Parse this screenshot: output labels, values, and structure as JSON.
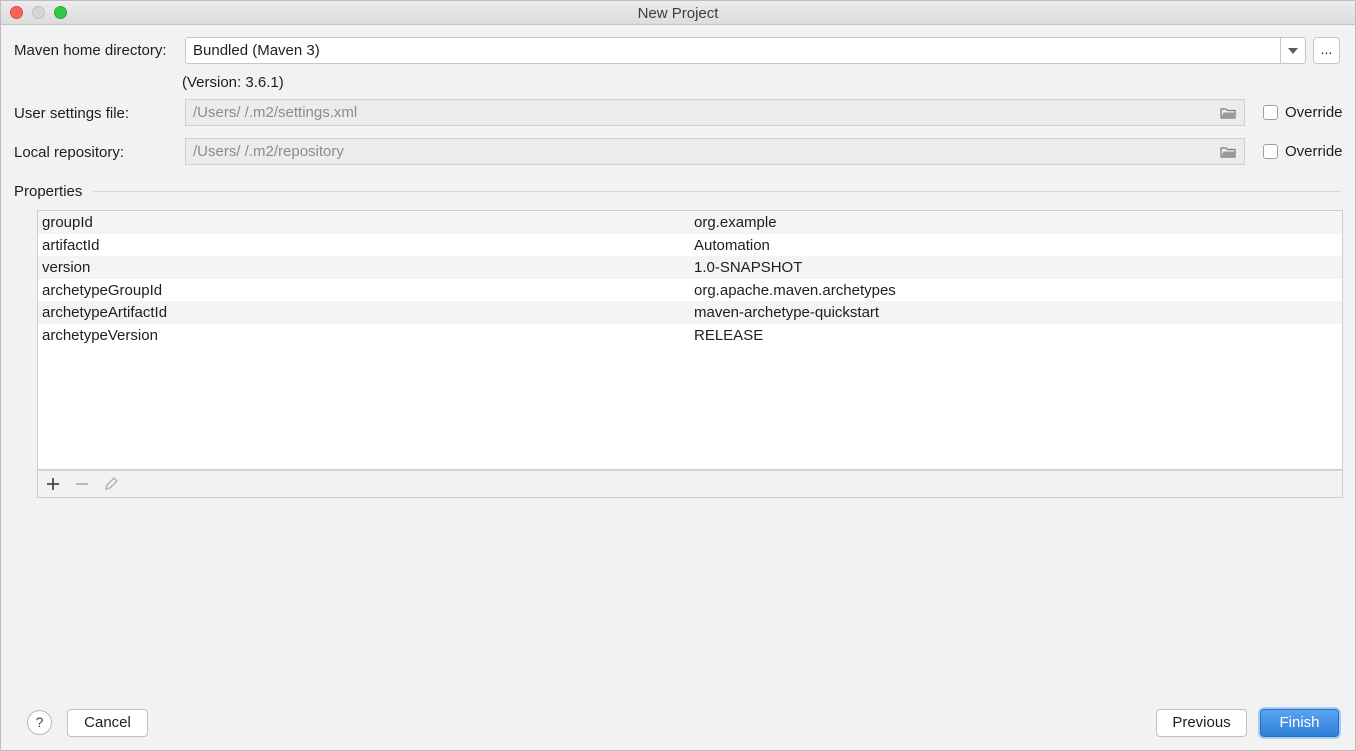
{
  "window": {
    "title": "New Project"
  },
  "form": {
    "maven_home_label": "Maven home directory:",
    "maven_home_value": "Bundled (Maven 3)",
    "maven_more_label": "...",
    "version_text": "(Version: 3.6.1)",
    "user_settings_label": "User settings file:",
    "user_settings_value": "/Users/        /.m2/settings.xml",
    "local_repo_label": "Local repository:",
    "local_repo_value": "/Users/        /.m2/repository",
    "override_label": "Override"
  },
  "properties": {
    "section_label": "Properties",
    "rows": [
      {
        "key": "groupId",
        "value": "org.example"
      },
      {
        "key": "artifactId",
        "value": "Automation"
      },
      {
        "key": "version",
        "value": "1.0-SNAPSHOT"
      },
      {
        "key": "archetypeGroupId",
        "value": "org.apache.maven.archetypes"
      },
      {
        "key": "archetypeArtifactId",
        "value": "maven-archetype-quickstart"
      },
      {
        "key": "archetypeVersion",
        "value": "RELEASE"
      }
    ]
  },
  "footer": {
    "help_label": "?",
    "cancel_label": "Cancel",
    "previous_label": "Previous",
    "finish_label": "Finish"
  },
  "icons": {
    "add": "plus-icon",
    "remove": "minus-icon",
    "edit": "pencil-icon",
    "browse": "folder-icon",
    "dropdown": "chevron-down-icon"
  },
  "colors": {
    "accent": "#2f7fd8",
    "close": "#fc605c",
    "maximize": "#34c84a"
  }
}
